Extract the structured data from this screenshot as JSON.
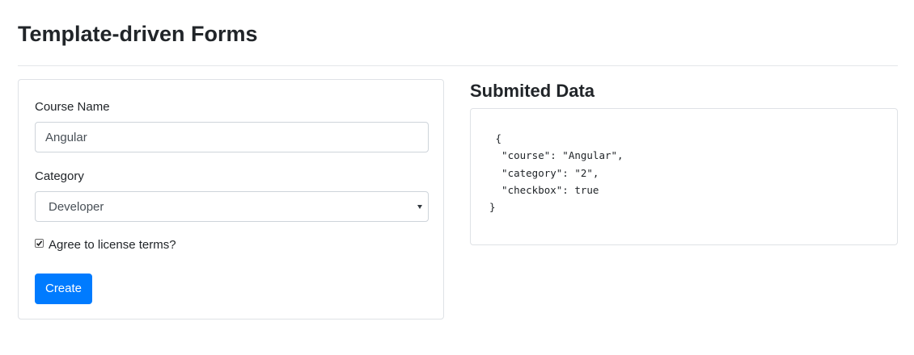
{
  "page": {
    "title": "Template-driven Forms"
  },
  "form": {
    "course_label": "Course Name",
    "course_value": "Angular",
    "category_label": "Category",
    "category_selected": "Developer",
    "agree_checked": true,
    "agree_label": "Agree to license terms?",
    "create_label": "Create"
  },
  "submitted": {
    "title": "Submited Data",
    "json_text": " {\n  \"course\": \"Angular\",\n  \"category\": \"2\",\n  \"checkbox\": true\n}"
  },
  "icons": {
    "select_caret": "chevron-down-icon",
    "checkbox_mark": "check-icon"
  },
  "colors": {
    "primary": "#007bff",
    "text": "#212529",
    "input_text": "#495057",
    "border": "#dfe2e6"
  }
}
